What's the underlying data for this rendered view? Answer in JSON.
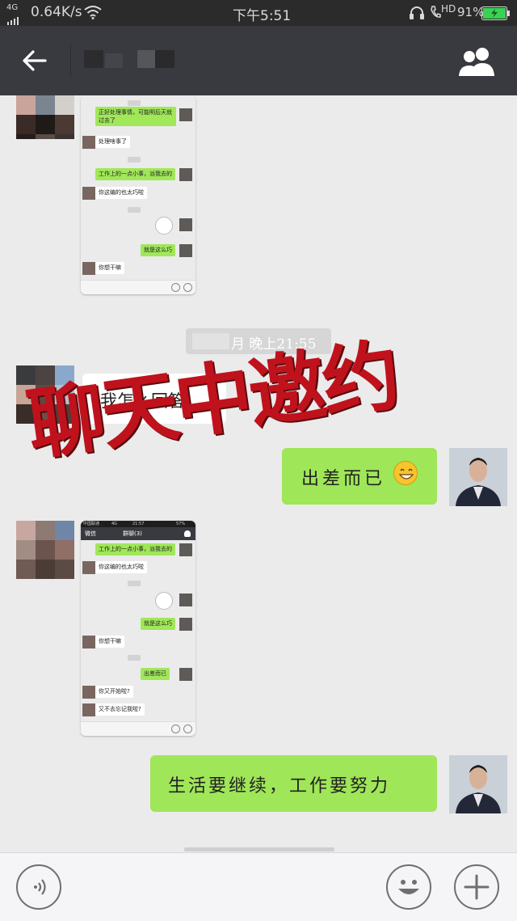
{
  "status_bar": {
    "network": "4G",
    "speed": "0.64K/s",
    "time": "下午5:51",
    "hd_label": "HD",
    "battery": "91%"
  },
  "nav": {
    "back_icon": "arrow-left-icon",
    "chat_info_icon": "people-icon"
  },
  "chat": {
    "time_divider": "月 晚上21:55",
    "message_me_1": "出差而已",
    "message_me_1_emoji": "grin-emoji",
    "message_them_partial": "我怎么回答",
    "message_me_2": "生活要继续，工作要努力",
    "overlay_caption": "聊天中邀约"
  },
  "screenshot_1": {
    "messages": [
      "正好处理事情，可能明后天就过去了",
      "处理啥事了",
      "工作上的一点小事，派我去的",
      "你这编的也太巧啦",
      "就是这么巧",
      "你想干嘛"
    ]
  },
  "screenshot_2": {
    "status_left": "中国联通",
    "status_net": "4G",
    "status_time": "21:57",
    "status_battery": "57%",
    "title": "群聊(3)",
    "back_label": "微信",
    "messages": [
      "工作上的一点小事，派我去的",
      "你这编的也太巧啦",
      "就是这么巧",
      "你想干嘛",
      "出差而已",
      "你又开始啦?",
      "又不去忘记我啦?"
    ]
  },
  "colors": {
    "my_bubble": "#9fe658",
    "their_bubble": "#ffffff",
    "nav_bg": "#393a3f",
    "status_bg": "#2b2b2b",
    "chat_bg": "#ebebeb",
    "overlay_red": "#c0121c"
  },
  "input_bar": {
    "voice_icon": "voice-icon",
    "emoji_icon": "smiley-icon",
    "more_icon": "plus-icon"
  }
}
